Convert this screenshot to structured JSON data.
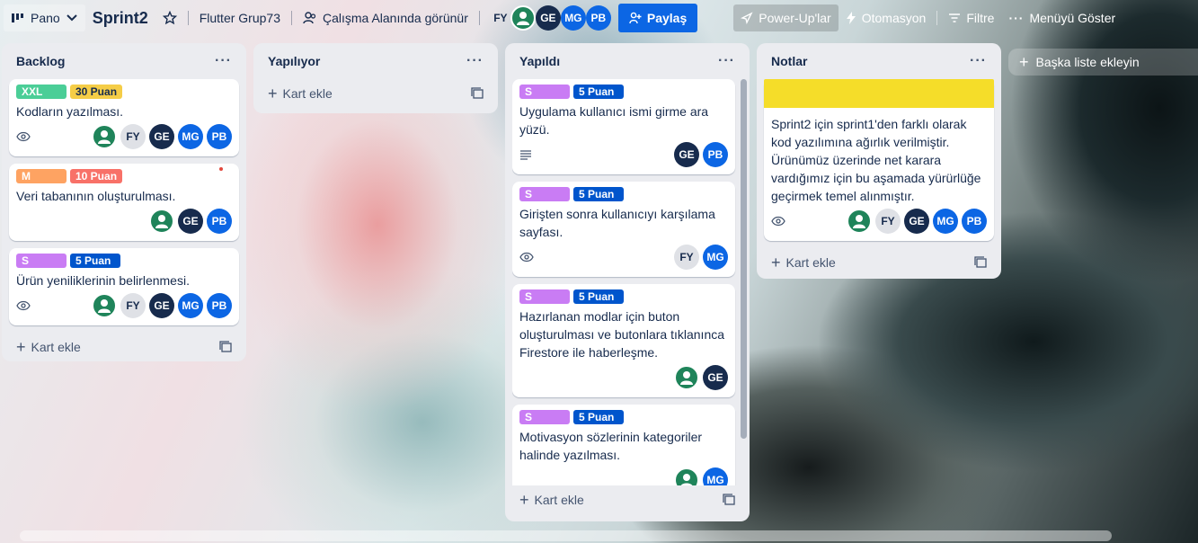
{
  "topbar": {
    "board_view": "Pano",
    "board_name": "Sprint2",
    "workspace": "Flutter Grup73",
    "visibility": "Çalışma Alanında görünür",
    "share": "Paylaş",
    "power_ups": "Power-Up'lar",
    "automation": "Otomasyon",
    "filter": "Filtre",
    "menu": "Menüyü Göster",
    "members": [
      "FY",
      "GE",
      "MG",
      "PB"
    ]
  },
  "lists": [
    {
      "title": "Backlog",
      "add": "Kart ekle",
      "cards": [
        {
          "labels": [
            {
              "text": "XXL",
              "color": "green"
            },
            {
              "text": "30 Puan",
              "color": "yellow"
            }
          ],
          "title": "Kodların yazılması.",
          "members": [
            "FY",
            "GE",
            "MG",
            "PB"
          ]
        },
        {
          "labels": [
            {
              "text": "M",
              "color": "orange"
            },
            {
              "text": "10 Puan",
              "color": "red"
            }
          ],
          "title": "Veri tabanının oluşturulması.",
          "members": [
            "GE",
            "PB"
          ]
        },
        {
          "labels": [
            {
              "text": "S",
              "color": "purple"
            },
            {
              "text": "5 Puan",
              "color": "blue"
            }
          ],
          "title": "Ürün yeniliklerinin belirlenmesi.",
          "members": [
            "FY",
            "GE",
            "MG",
            "PB"
          ]
        }
      ]
    },
    {
      "title": "Yapılıyor",
      "add": "Kart ekle",
      "cards": []
    },
    {
      "title": "Yapıldı",
      "add": "Kart ekle",
      "cards": [
        {
          "labels": [
            {
              "text": "S",
              "color": "purple"
            },
            {
              "text": "5 Puan",
              "color": "blue"
            }
          ],
          "title": "Uygulama kullanıcı ismi girme ara yüzü.",
          "members": [
            "GE",
            "PB"
          ]
        },
        {
          "labels": [
            {
              "text": "S",
              "color": "purple"
            },
            {
              "text": "5 Puan",
              "color": "blue"
            }
          ],
          "title": "Girişten sonra kullanıcıyı karşılama sayfası.",
          "members": [
            "FY",
            "MG"
          ]
        },
        {
          "labels": [
            {
              "text": "S",
              "color": "purple"
            },
            {
              "text": "5 Puan",
              "color": "blue"
            }
          ],
          "title": "Hazırlanan modlar için buton oluşturulması ve butonlara tıklanınca Firestore ile haberleşme.",
          "members": [
            "GE"
          ]
        },
        {
          "labels": [
            {
              "text": "S",
              "color": "purple"
            },
            {
              "text": "5 Puan",
              "color": "blue"
            }
          ],
          "title": "Motivasyon sözlerinin kategoriler halinde yazılması.",
          "members": [
            "MG"
          ]
        }
      ]
    },
    {
      "title": "Notlar",
      "add": "Kart ekle",
      "cards": [
        {
          "title": "Sprint2 için sprint1'den farklı olarak kod yazılımına ağırlık verilmiştir. Ürünümüz üzerinde net karara vardığımız için bu aşamada yürürlüğe geçirmek temel alınmıştır.",
          "members": [
            "FY",
            "GE",
            "MG",
            "PB"
          ]
        }
      ]
    }
  ],
  "add_list": "Başka liste ekleyin"
}
